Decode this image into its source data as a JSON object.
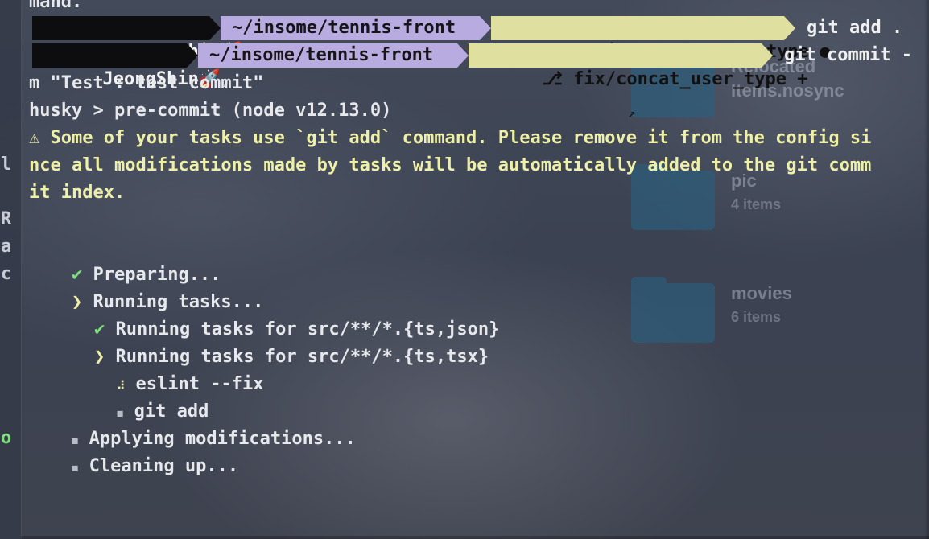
{
  "finder": {
    "items": [
      {
        "name": "Relocated",
        "name2": "Items.nosync"
      },
      {
        "name": "pic",
        "count": "4 items"
      },
      {
        "name": "movies",
        "count": "6 items"
      }
    ]
  },
  "sidebar_chars": [
    "l",
    "R",
    "a",
    "c",
    "o"
  ],
  "terminal": {
    "top_partial": "mand.",
    "prompt1": {
      "status": "✘",
      "user": "JeongShin🚀,",
      "path": "~/insome/tennis-front",
      "branch_icon": "⎇",
      "branch": "fix/concat_user_type ●",
      "command": "git add ."
    },
    "prompt2": {
      "user": "JeongShin🚀,",
      "path": "~/insome/tennis-front",
      "branch_icon": "⎇",
      "branch": "fix/concat_user_type +",
      "command": "git commit -"
    },
    "command_cont": "m \"Test : test commit\"",
    "husky": "husky > pre-commit (node v12.13.0)",
    "warning_lines": [
      "⚠ Some of your tasks use `git add` command. Please remove it from the config si",
      "nce all modifications made by tasks will be automatically added to the git comm",
      "it index."
    ],
    "tasks": [
      {
        "mark": "✔",
        "text": "Preparing..."
      },
      {
        "mark": "❯",
        "text": "Running tasks..."
      },
      {
        "mark": "✔",
        "text": "Running tasks for src/**/*.{ts,json}"
      },
      {
        "mark": "❯",
        "text": "Running tasks for src/**/*.{ts,tsx}"
      },
      {
        "mark": "⠼",
        "text": "eslint --fix"
      },
      {
        "mark": "◼",
        "text": "git add"
      },
      {
        "mark": "◼",
        "text": "Applying modifications..."
      },
      {
        "mark": "◼",
        "text": "Cleaning up..."
      }
    ]
  },
  "colors": {
    "prompt_user_bg": "#0d0d10",
    "prompt_path_bg": "#b8abe0",
    "prompt_git_bg": "#dfe0a0",
    "warning": "#eef0a8",
    "success": "#7ee07c"
  }
}
